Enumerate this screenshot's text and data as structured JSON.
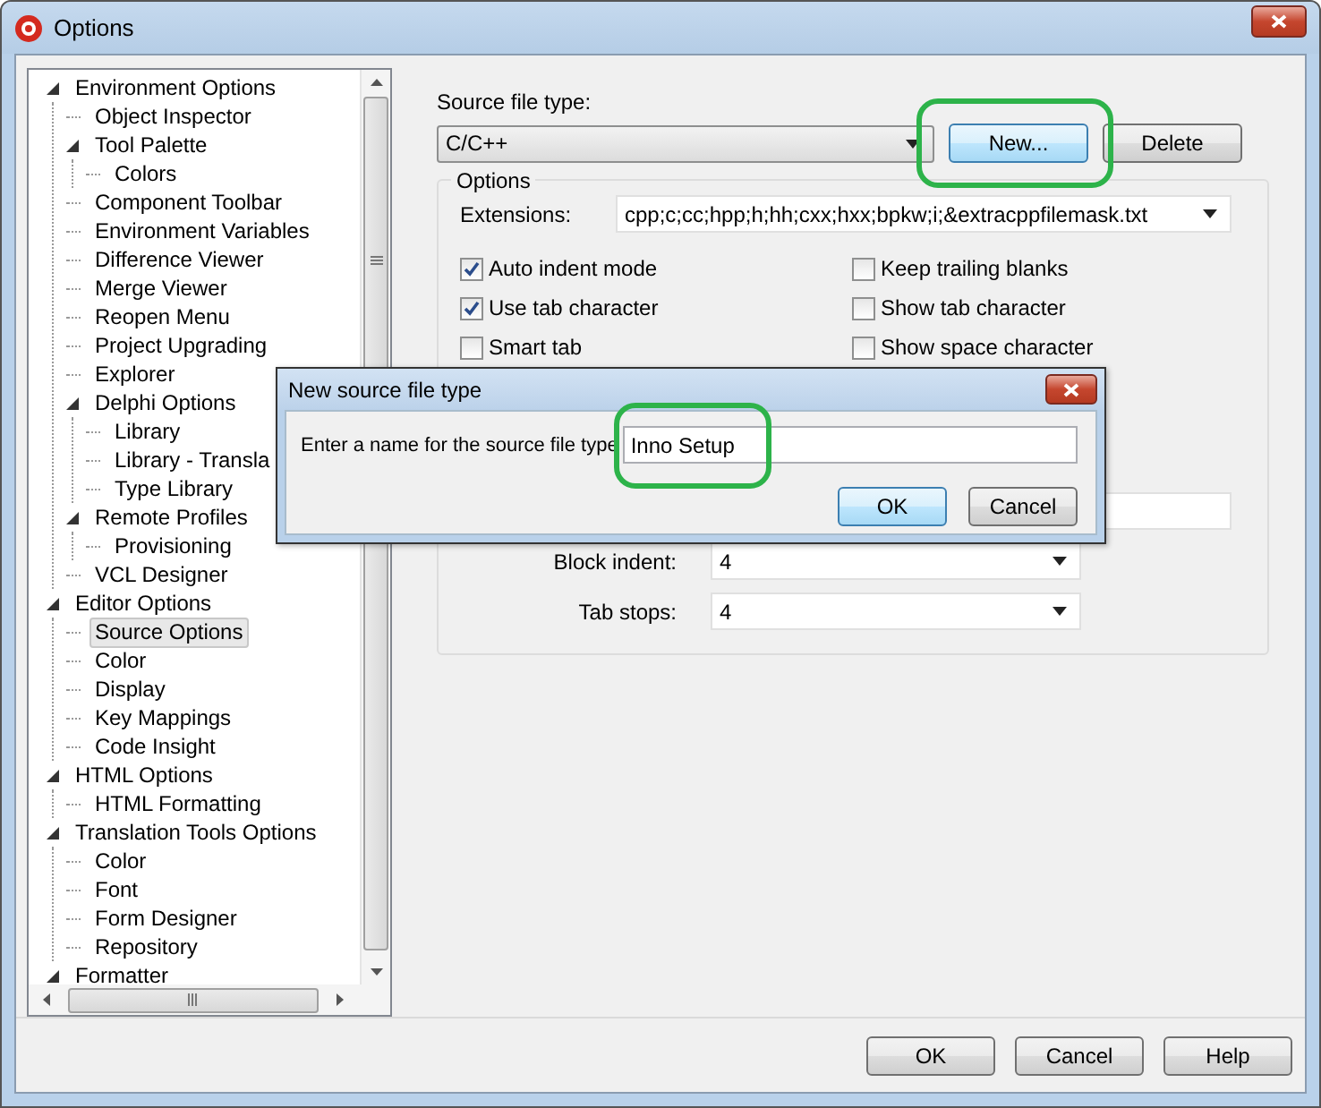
{
  "window": {
    "title": "Options"
  },
  "tree": [
    {
      "label": "Environment Options",
      "selected": false,
      "expanded": true,
      "children": [
        {
          "label": "Object Inspector",
          "selected": false
        },
        {
          "label": "Tool Palette",
          "selected": false,
          "expanded": true,
          "children": [
            {
              "label": "Colors",
              "selected": false
            }
          ]
        },
        {
          "label": "Component Toolbar",
          "selected": false
        },
        {
          "label": "Environment Variables",
          "selected": false
        },
        {
          "label": "Difference Viewer",
          "selected": false
        },
        {
          "label": "Merge Viewer",
          "selected": false
        },
        {
          "label": "Reopen Menu",
          "selected": false
        },
        {
          "label": "Project Upgrading",
          "selected": false
        },
        {
          "label": "Explorer",
          "selected": false
        },
        {
          "label": "Delphi Options",
          "selected": false,
          "expanded": true,
          "children": [
            {
              "label": "Library",
              "selected": false
            },
            {
              "label": "Library - Transla",
              "selected": false
            },
            {
              "label": "Type Library",
              "selected": false
            }
          ]
        },
        {
          "label": "Remote Profiles",
          "selected": false,
          "expanded": true,
          "children": [
            {
              "label": "Provisioning",
              "selected": false
            }
          ]
        },
        {
          "label": "VCL Designer",
          "selected": false
        }
      ]
    },
    {
      "label": "Editor Options",
      "selected": false,
      "expanded": true,
      "children": [
        {
          "label": "Source Options",
          "selected": true
        },
        {
          "label": "Color",
          "selected": false
        },
        {
          "label": "Display",
          "selected": false
        },
        {
          "label": "Key Mappings",
          "selected": false
        },
        {
          "label": "Code Insight",
          "selected": false
        }
      ]
    },
    {
      "label": "HTML Options",
      "selected": false,
      "expanded": true,
      "children": [
        {
          "label": "HTML Formatting",
          "selected": false
        }
      ]
    },
    {
      "label": "Translation Tools Options",
      "selected": false,
      "expanded": true,
      "children": [
        {
          "label": "Color",
          "selected": false
        },
        {
          "label": "Font",
          "selected": false
        },
        {
          "label": "Form Designer",
          "selected": false
        },
        {
          "label": "Repository",
          "selected": false
        }
      ]
    },
    {
      "label": "Formatter",
      "selected": false,
      "expanded": true
    }
  ],
  "source_file_type": {
    "label": "Source file type:",
    "value": "C/C++"
  },
  "source_buttons": [
    "New...",
    "Delete"
  ],
  "options": {
    "title": "Options",
    "extensions_label": "Extensions:",
    "extensions_value": "cpp;c;cc;hpp;h;hh;cxx;hxx;bpkw;i;&extracppfilemask.txt",
    "checkboxes": [
      {
        "label": "Auto indent mode",
        "checked": true
      },
      {
        "label": "Keep trailing blanks",
        "checked": false
      },
      {
        "label": "Use tab character",
        "checked": true
      },
      {
        "label": "Show tab character",
        "checked": false
      },
      {
        "label": "Smart tab",
        "checked": false
      },
      {
        "label": "Show space character",
        "checked": false
      }
    ],
    "block_indent": {
      "label": "Block indent:",
      "value": "4"
    },
    "tab_stops": {
      "label": "Tab stops:",
      "value": "4"
    }
  },
  "dialog": {
    "title": "New source file type",
    "prompt": "Enter a name for the source file type",
    "value": "Inno Setup",
    "buttons": [
      "OK",
      "Cancel"
    ]
  },
  "buttons": [
    "OK",
    "Cancel",
    "Help"
  ]
}
